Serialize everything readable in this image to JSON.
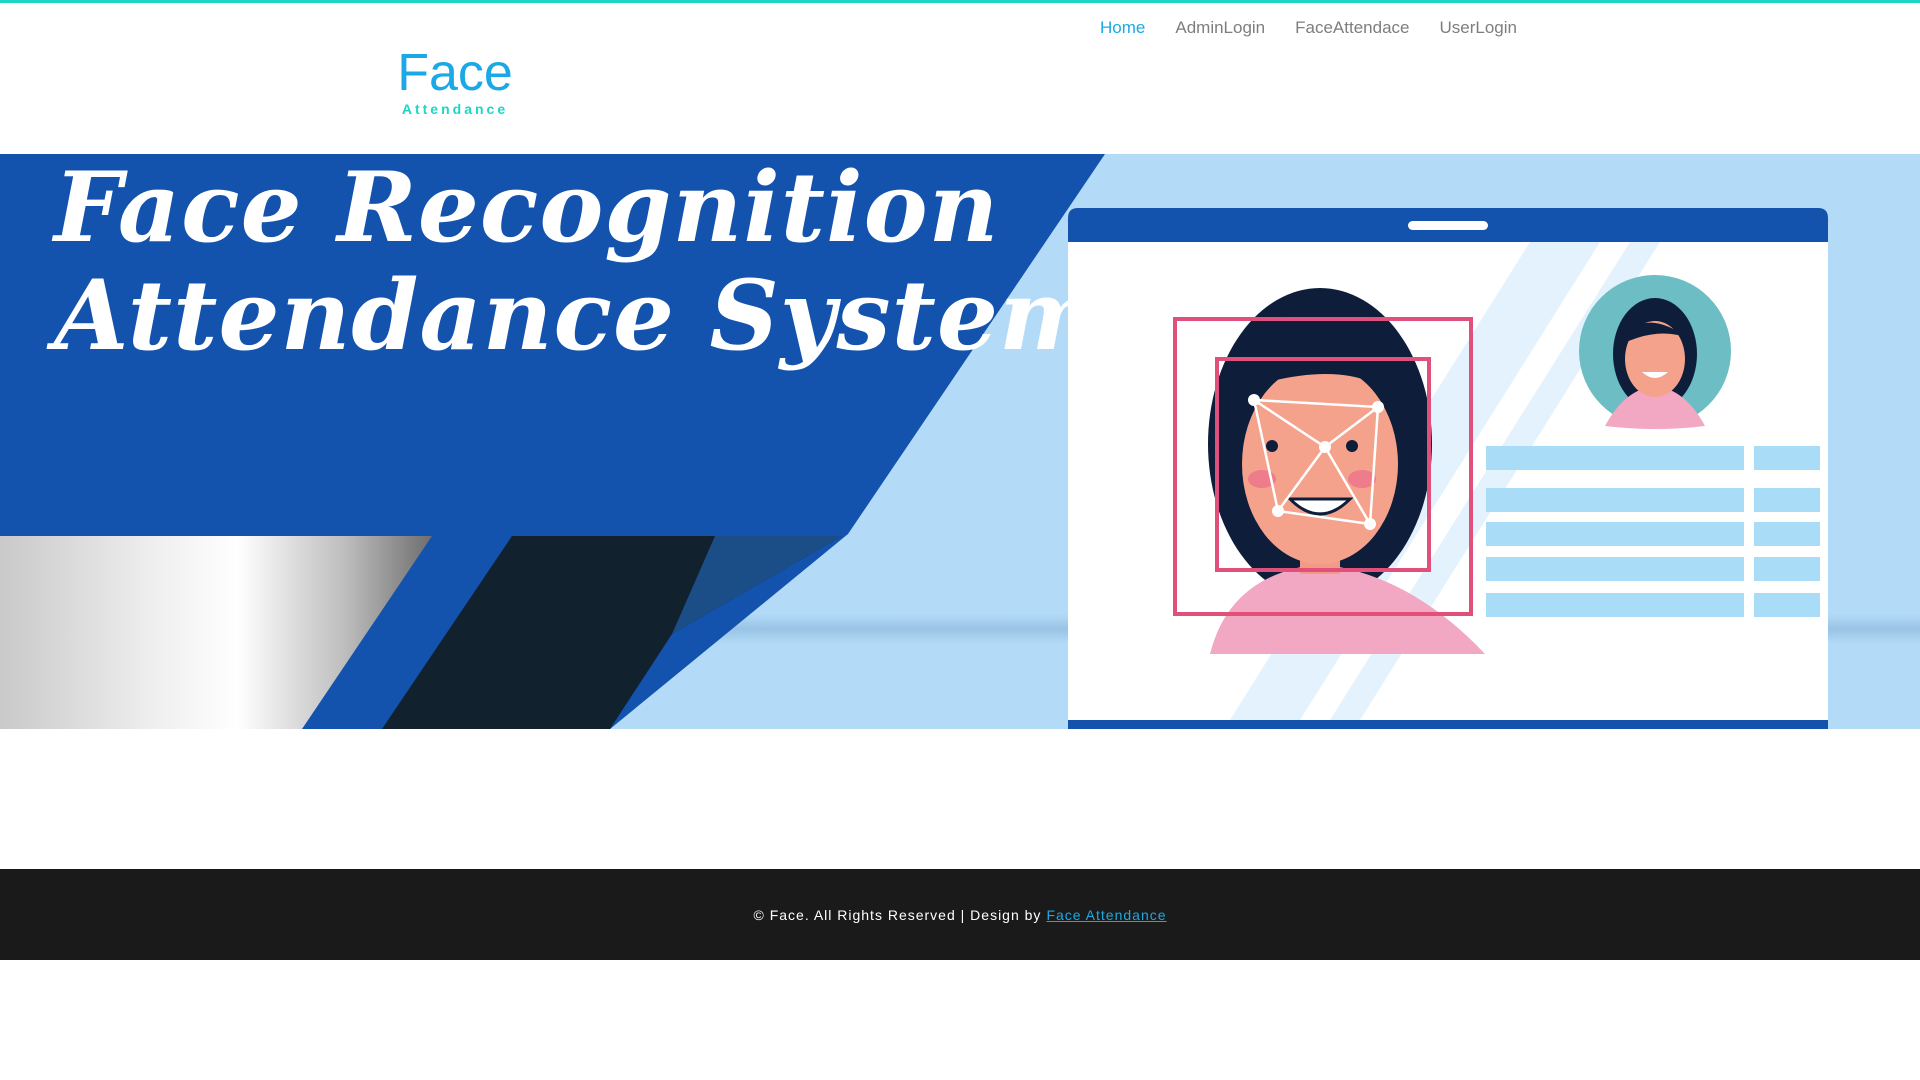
{
  "logo": {
    "title": "Face",
    "subtitle": "Attendance"
  },
  "nav": {
    "items": [
      {
        "label": "Home",
        "active": true
      },
      {
        "label": "AdminLogin"
      },
      {
        "label": "FaceAttendace"
      },
      {
        "label": "UserLogin"
      }
    ]
  },
  "banner": {
    "title_line1": "Face Recognition",
    "title_line2": "Attendance System"
  },
  "footer": {
    "text": "© Face. All Rights Reserved | Design by",
    "link_label": "Face Attendance"
  },
  "colors": {
    "accent": "#1aa9e6",
    "top_border": "#1fd6c4",
    "banner_blue": "#1352ad",
    "banner_light": "#b3dbf8",
    "footer_bg": "#1a1a1a"
  }
}
